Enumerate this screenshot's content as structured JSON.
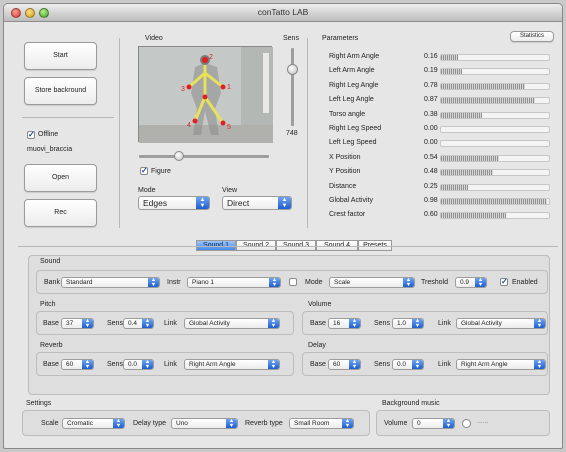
{
  "window": {
    "title": "conTatto LAB"
  },
  "left": {
    "start_label": "Start",
    "store_label": "Store backround",
    "offline_label": "Offline",
    "offline_checked": true,
    "file_name": "muovi_braccia",
    "open_label": "Open",
    "rec_label": "Rec"
  },
  "video": {
    "title": "Video",
    "sens_label": "Sens",
    "sens_value": "748",
    "figure_label": "Figure",
    "figure_checked": true,
    "points": [
      "1",
      "2",
      "3",
      "4",
      "5"
    ],
    "mode_label": "Mode",
    "mode_value": "Edges",
    "view_label": "View",
    "view_value": "Direct"
  },
  "params": {
    "title": "Parameters",
    "statistics_label": "Statistics",
    "rows": [
      {
        "name": "Right Arm Angle",
        "value": "0.16"
      },
      {
        "name": "Left Arm Angle",
        "value": "0.19"
      },
      {
        "name": "Right Leg Angle",
        "value": "0.78"
      },
      {
        "name": "Left Leg Angle",
        "value": "0.87"
      },
      {
        "name": "Torso angle",
        "value": "0.38"
      },
      {
        "name": "Right Leg Speed",
        "value": "0.00"
      },
      {
        "name": "Left Leg Speed",
        "value": "0.00"
      },
      {
        "name": "X Position",
        "value": "0.54"
      },
      {
        "name": "Y Position",
        "value": "0.48"
      },
      {
        "name": "Distance",
        "value": "0.25"
      },
      {
        "name": "Global Activity",
        "value": "0.98"
      },
      {
        "name": "Crest factor",
        "value": "0.60"
      }
    ]
  },
  "tabs": [
    "Sound 1",
    "Sound 2",
    "Sound 3",
    "Sound 4",
    "Presets"
  ],
  "sound": {
    "title": "Sound",
    "bank_label": "Bank",
    "bank_value": "Standard",
    "instr_label": "Instr",
    "instr_value": "Piano 1",
    "mode_label": "Mode",
    "mode_value": "Scale",
    "treshold_label": "Treshold",
    "treshold_value": "0.9",
    "enabled_label": "Enabled",
    "enabled_checked": true
  },
  "pitch": {
    "title": "Pitch",
    "base_label": "Base",
    "base_value": "37",
    "sens_label": "Sens",
    "sens_value": "0.4",
    "link_label": "Link",
    "link_value": "Global Activity"
  },
  "volume": {
    "title": "Volume",
    "base_label": "Base",
    "base_value": "16",
    "sens_label": "Sens",
    "sens_value": "1.0",
    "link_label": "Link",
    "link_value": "Global Activity"
  },
  "reverb": {
    "title": "Reverb",
    "base_label": "Base",
    "base_value": "60",
    "sens_label": "Sens",
    "sens_value": "0.0",
    "link_label": "Link",
    "link_value": "Right Arm Angle"
  },
  "delay": {
    "title": "Delay",
    "base_label": "Base",
    "base_value": "60",
    "sens_label": "Sens",
    "sens_value": "0.0",
    "link_label": "Link",
    "link_value": "Right Arm Angle"
  },
  "settings": {
    "title": "Settings",
    "scale_label": "Scale",
    "scale_value": "Cromatic",
    "delay_type_label": "Delay type",
    "delay_type_value": "Uno",
    "reverb_type_label": "Reverb type",
    "reverb_type_value": "Small Room"
  },
  "music": {
    "title": "Background music",
    "volume_label": "Volume",
    "volume_value": "0",
    "dots": "......"
  }
}
